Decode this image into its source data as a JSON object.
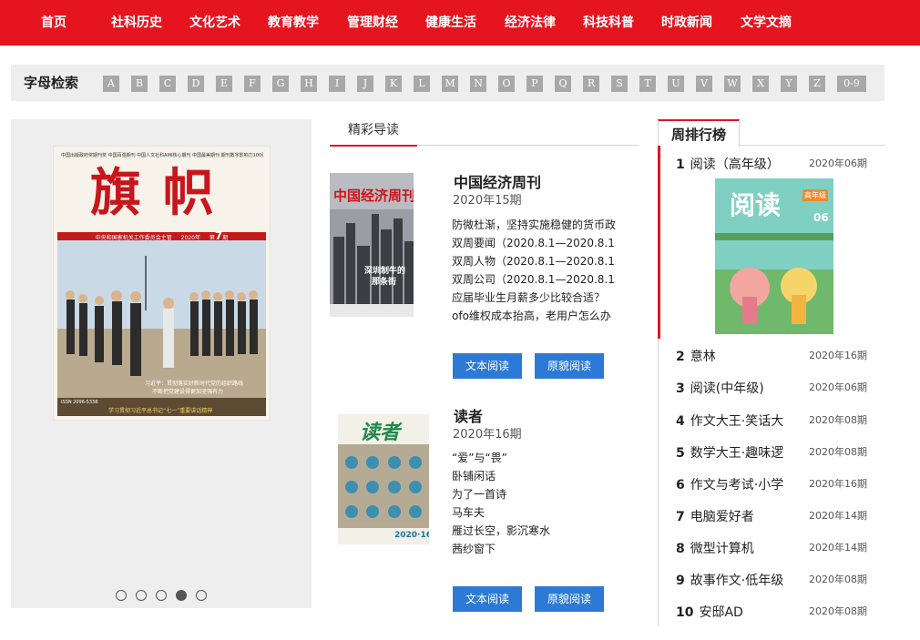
{
  "nav": {
    "items": [
      "首页",
      "社科历史",
      "文化艺术",
      "教育教学",
      "管理财经",
      "健康生活",
      "经济法律",
      "科技科普",
      "时政新闻",
      "文学文摘"
    ]
  },
  "letter_search": {
    "label": "字母检索",
    "letters": [
      "A",
      "B",
      "C",
      "D",
      "E",
      "F",
      "G",
      "H",
      "I",
      "J",
      "K",
      "L",
      "M",
      "N",
      "O",
      "P",
      "Q",
      "R",
      "S",
      "T",
      "U",
      "V",
      "W",
      "X",
      "Y",
      "Z",
      "0-9"
    ]
  },
  "slider": {
    "cover": {
      "header_line": "中国出版政府奖期刊奖  中国百强期刊  中国人文社科AMI核心期刊  中国最美期刊  期刊数字影响力100强",
      "title": "旗帜",
      "subtitle": "中央和国家机关工作委员会主管",
      "year": "2020年",
      "issue_prefix": "第",
      "issue_no": "7",
      "issue_suffix": "期",
      "caption1": "习近平：贯彻落实好新时代党的组织路线",
      "caption2": "不断把党建设得更加坚强有力",
      "caption3": "学习贯彻习近平总书记“七一”重要讲话精神",
      "issn": "ISSN 2096-5338"
    },
    "dots": 5,
    "active_dot": 3
  },
  "featured": {
    "tab_label": "精彩导读",
    "magazines": [
      {
        "title": "中国经济周刊",
        "issue": "2020年15期",
        "articles": [
          "防微杜渐，坚持实施稳健的货币政",
          "双周要闻（2020.8.1—2020.8.15",
          "双周人物（2020.8.1—2020.8.15",
          "双周公司（2020.8.1—2020.8.15",
          "应届毕业生月薪多少比较合适？",
          "ofo维权成本抬高，老用户怎么办"
        ],
        "cover": {
          "title": "中国经济周刊",
          "headline": "深圳制牛的",
          "headline2": "那条街"
        },
        "btn_text": "文本阅读",
        "btn_orig": "原貌阅读"
      },
      {
        "title": "读者",
        "issue": "2020年16期",
        "articles": [
          "“爱”与“畏”",
          "卧铺闲话",
          "为了一首诗",
          "马车夫",
          "雁过长空，影沉寒水",
          "茜纱窗下"
        ],
        "cover": {
          "title": "读者",
          "issue_mark": "2020·16"
        },
        "btn_text": "文本阅读",
        "btn_orig": "原貌阅读"
      }
    ]
  },
  "ranking": {
    "title": "周排行榜",
    "cover": {
      "title": "阅读",
      "badge": "高年级",
      "issue": "06"
    },
    "items": [
      {
        "rank": "1",
        "name": "阅读（高年级）",
        "date": "2020年06期"
      },
      {
        "rank": "2",
        "name": "意林",
        "date": "2020年16期"
      },
      {
        "rank": "3",
        "name": "阅读(中年级)",
        "date": "2020年06期"
      },
      {
        "rank": "4",
        "name": "作文大王·笑话大",
        "date": "2020年08期"
      },
      {
        "rank": "5",
        "name": "数学大王·趣味逻",
        "date": "2020年08期"
      },
      {
        "rank": "6",
        "name": "作文与考试·小学",
        "date": "2020年16期"
      },
      {
        "rank": "7",
        "name": "电脑爱好者",
        "date": "2020年14期"
      },
      {
        "rank": "8",
        "name": "微型计算机",
        "date": "2020年14期"
      },
      {
        "rank": "9",
        "name": "故事作文·低年级",
        "date": "2020年08期"
      },
      {
        "rank": "10",
        "name": "安邸AD",
        "date": "2020年08期"
      }
    ]
  },
  "colors": {
    "brand_red": "#e5141e",
    "button_blue": "#2d7ad6",
    "letter_gray": "#a8a8a8"
  }
}
